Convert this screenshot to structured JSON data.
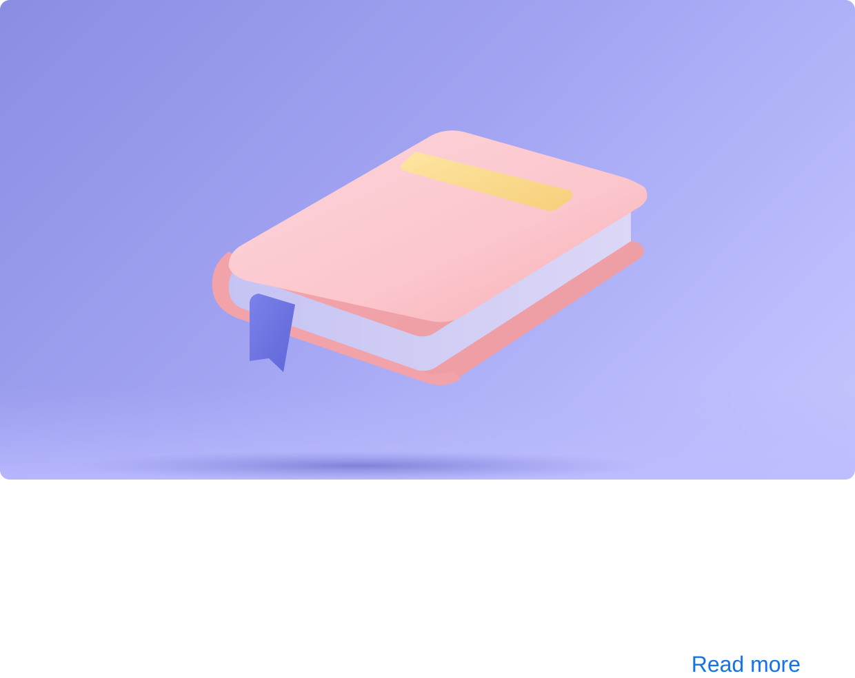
{
  "card": {
    "read_more_label": "Read more"
  },
  "colors": {
    "hero_background": "#9fa1f0",
    "book_cover": "#f7b4b8",
    "book_label": "#fbd98c",
    "bookmark": "#6f75e0",
    "link": "#1673e6"
  },
  "icons": {
    "illustration": "book-icon",
    "ribbon": "bookmark-icon"
  }
}
